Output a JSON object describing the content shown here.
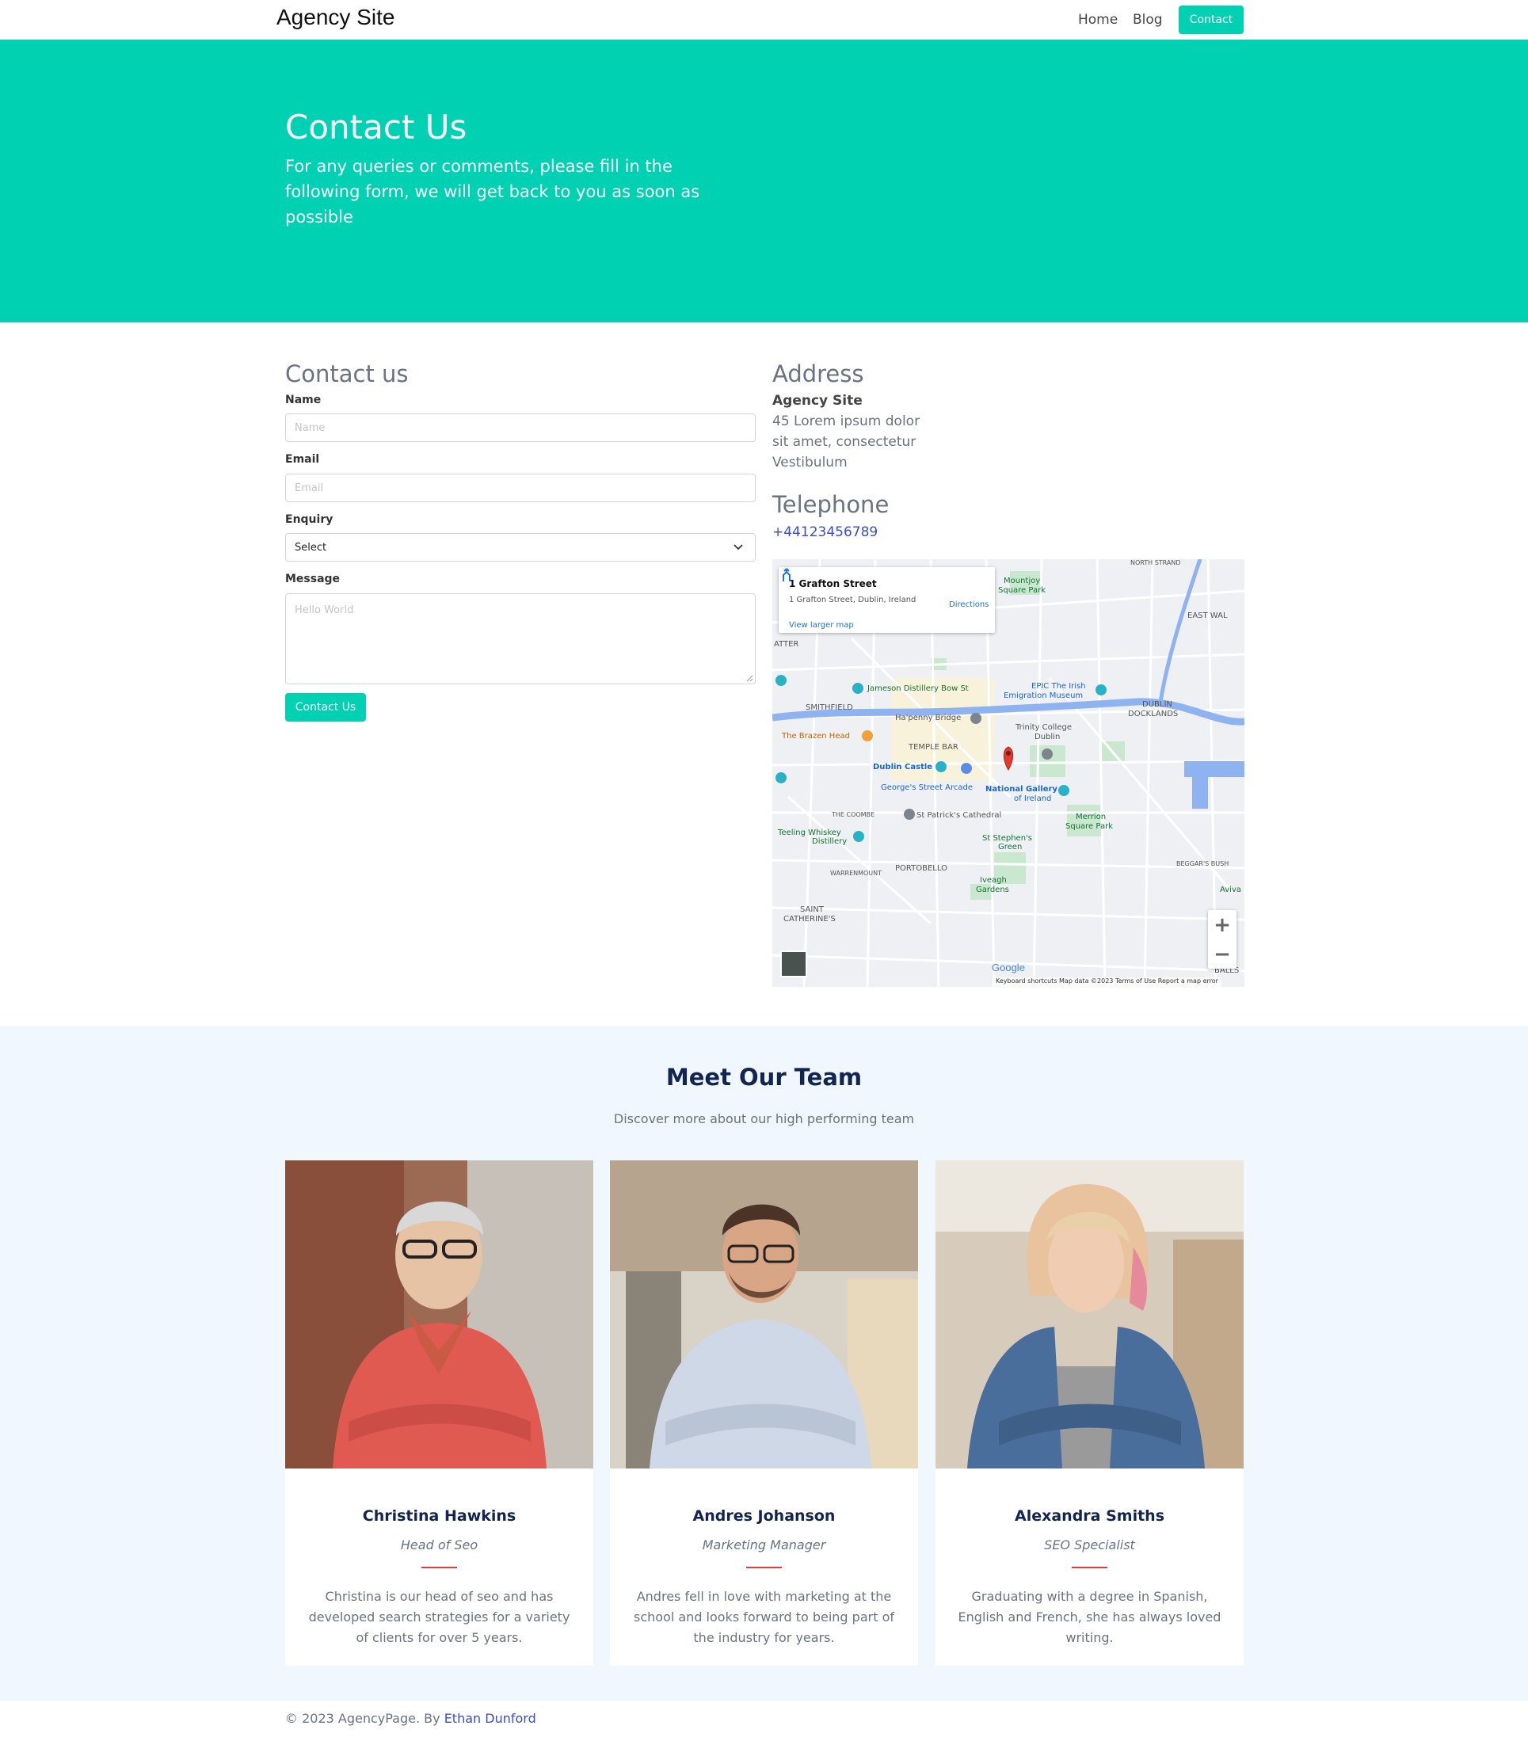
{
  "nav": {
    "brand": "Agency Site",
    "home": "Home",
    "blog": "Blog",
    "contact": "Contact"
  },
  "hero": {
    "title": "Contact Us",
    "subtitle": "For any queries or comments, please fill in the following form, we will get back to you as soon as possible"
  },
  "form": {
    "title": "Contact us",
    "name_label": "Name",
    "name_placeholder": "Name",
    "email_label": "Email",
    "email_placeholder": "Email",
    "enquiry_label": "Enquiry",
    "enquiry_value": "Select",
    "message_label": "Message",
    "message_placeholder": "Hello World",
    "submit": "Contact Us"
  },
  "address": {
    "title": "Address",
    "name": "Agency Site",
    "lines": [
      "45 Lorem ipsum dolor",
      "sit amet, consectetur",
      "Vestibulum"
    ],
    "tel_title": "Telephone",
    "tel": "+44123456789"
  },
  "map": {
    "card_title": "1 Grafton Street",
    "card_address": "1 Grafton Street, Dublin, Ireland",
    "directions": "Directions",
    "larger_map": "View larger map",
    "google": "Google",
    "footer": "Keyboard shortcuts   Map data ©2023   Terms of Use   Report a map error",
    "labels": [
      "ATTER",
      "SMITHFIELD",
      "TEMPLE BAR",
      "THE COOMBE",
      "PORTOBELLO",
      "WARRENMOUNT",
      "SAINT",
      "CATHERINE'S",
      "Jameson Distillery Bow St",
      "Ha'penny Bridge",
      "The Brazen Head",
      "Dublin Castle",
      "George's Street Arcade",
      "St Patrick's Cathedral",
      "Teeling Whiskey",
      "Distillery",
      "St Stephen's",
      "Green",
      "Iveagh",
      "Gardens",
      "Trinity College",
      "Dublin",
      "National Gallery",
      "of Ireland",
      "Merrion",
      "Square Park",
      "EPIC The Irish",
      "Emigration Museum",
      "DUBLIN",
      "DOCKLANDS",
      "Mountjoy",
      "Square Park",
      "NORTH STRAND",
      "EAST WAL",
      "BEGGAR'S BUSH",
      "Aviva",
      "BALLS"
    ]
  },
  "team": {
    "title": "Meet Our Team",
    "subtitle": "Discover more about our high performing team",
    "members": [
      {
        "name": "Christina Hawkins",
        "role": "Head of Seo",
        "bio": "Christina is our head of seo and has developed search strategies for a variety of clients for over 5 years."
      },
      {
        "name": "Andres Johanson",
        "role": "Marketing Manager",
        "bio": "Andres fell in love with marketing at the school and looks forward to being part of the industry for years."
      },
      {
        "name": "Alexandra Smiths",
        "role": "SEO Specialist",
        "bio": "Graduating with a degree in Spanish, English and French, she has always loved writing."
      }
    ]
  },
  "footer": {
    "text": "© 2023 AgencyPage. By ",
    "author": "Ethan Dunford"
  },
  "colors": {
    "accent": "#00d1b2",
    "heading": "#122552",
    "link": "#3b4cca",
    "team_bg": "#f0f7ff"
  }
}
